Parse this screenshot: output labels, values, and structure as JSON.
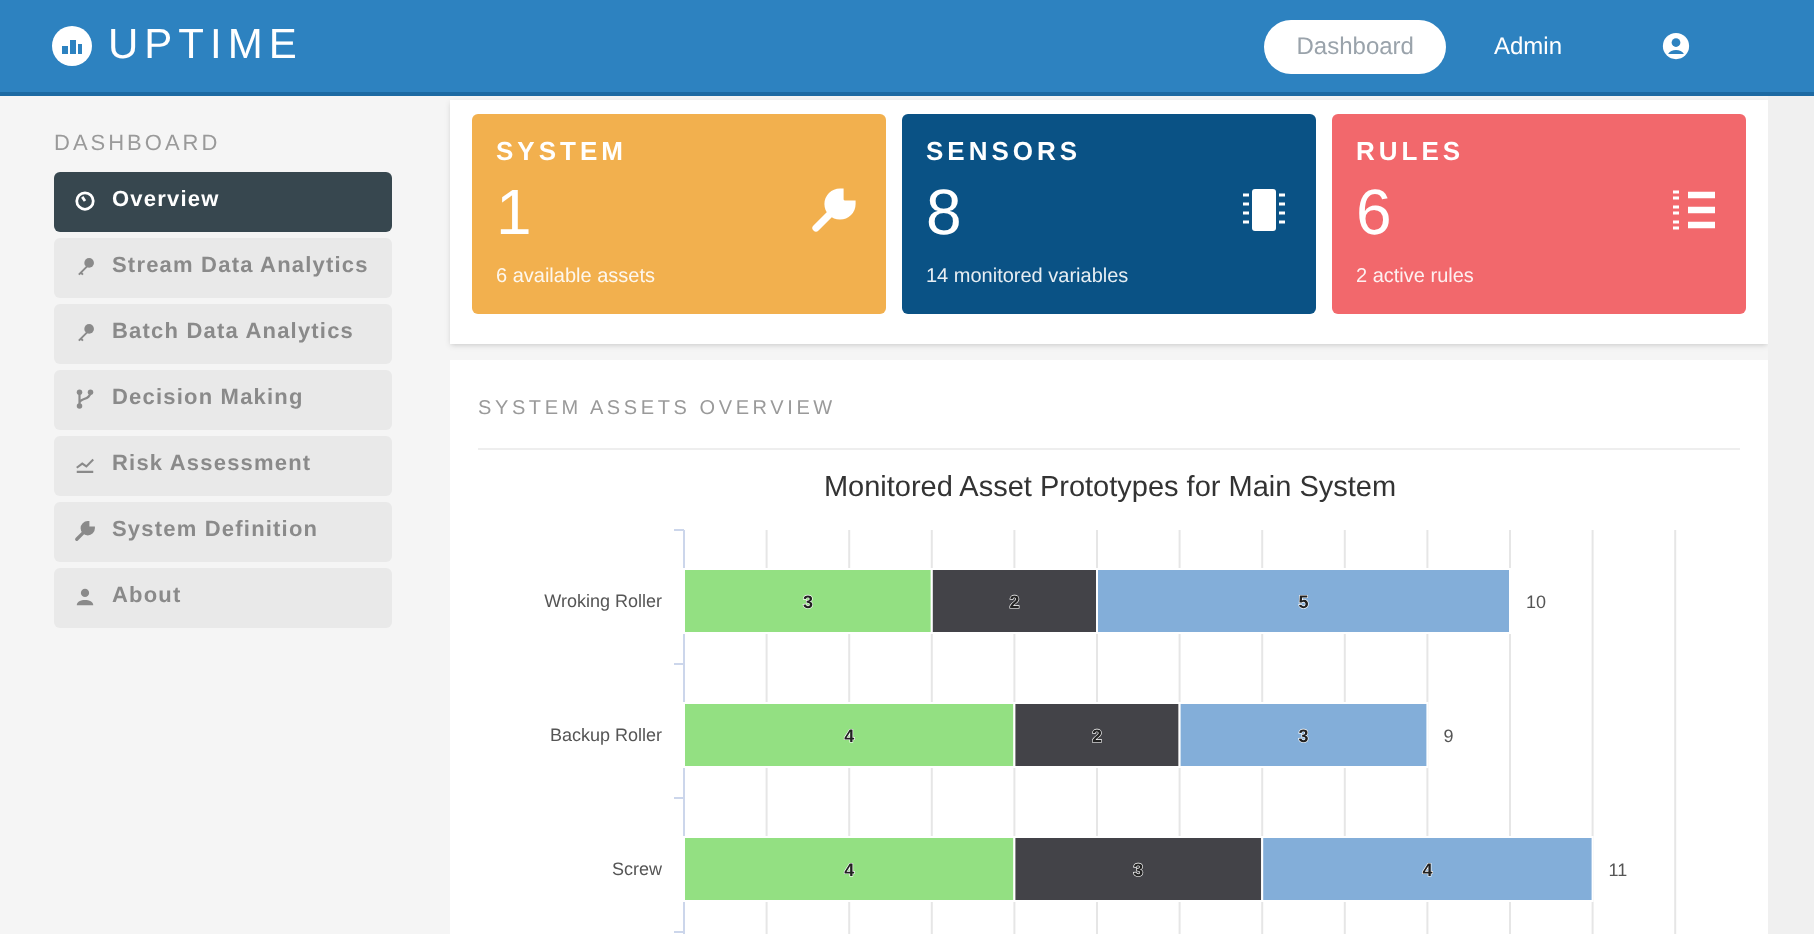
{
  "header": {
    "logo": "UPTIME",
    "nav": [
      {
        "label": "Dashboard",
        "selected": true
      },
      {
        "label": "Admin",
        "selected": false
      }
    ]
  },
  "sidebar": {
    "heading": "DASHBOARD",
    "items": [
      {
        "label": "Overview",
        "selected": true
      },
      {
        "label": "Stream Data Analytics",
        "selected": false
      },
      {
        "label": "Batch Data Analytics",
        "selected": false
      },
      {
        "label": "Decision Making",
        "selected": false
      },
      {
        "label": "Risk Assessment",
        "selected": false
      },
      {
        "label": "System Definition",
        "selected": false
      },
      {
        "label": "About",
        "selected": false
      }
    ]
  },
  "stat_cards": [
    {
      "title": "SYSTEM",
      "value": "1",
      "caption": "6 available assets",
      "color": "#f2b04e"
    },
    {
      "title": "SENSORS",
      "value": "8",
      "caption": "14 monitored variables",
      "color": "#0a5285"
    },
    {
      "title": "RULES",
      "value": "6",
      "caption": "2 active rules",
      "color": "#f2686c"
    }
  ],
  "assets_panel": {
    "heading": "SYSTEM ASSETS OVERVIEW",
    "chart_data": {
      "type": "bar",
      "orientation": "horizontal",
      "stacked": true,
      "title": "Monitored Asset Prototypes for Main System",
      "categories": [
        "Wroking Roller",
        "Backup Roller",
        "Screw"
      ],
      "series": [
        {
          "color": "#93e082",
          "values": [
            3,
            4,
            4
          ]
        },
        {
          "color": "#434348",
          "values": [
            2,
            2,
            3
          ]
        },
        {
          "color": "#83aed9",
          "values": [
            5,
            3,
            4
          ]
        }
      ],
      "data_labels": true,
      "totals": [
        "10",
        "9",
        "11"
      ],
      "xlim": [
        0,
        12
      ]
    }
  }
}
